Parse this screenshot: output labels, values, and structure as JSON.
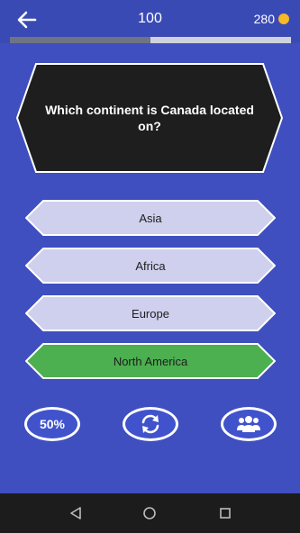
{
  "header": {
    "back_icon": "arrow-left-icon",
    "score": "100",
    "coins": "280",
    "coin_icon": "gold-coin-icon",
    "progress": 0.5
  },
  "question": {
    "text": "Which continent is Canada located on?"
  },
  "options": [
    {
      "label": "Asia",
      "state": "default"
    },
    {
      "label": "Africa",
      "state": "default"
    },
    {
      "label": "Europe",
      "state": "default"
    },
    {
      "label": "North America",
      "state": "correct"
    }
  ],
  "lifelines": {
    "fifty_fifty_label": "50%",
    "swap_icon": "refresh-icon",
    "audience_icon": "group-icon"
  },
  "colors": {
    "background": "#3f4fc0",
    "option_default": "#cfd0ee",
    "option_correct": "#4caf50",
    "question_bg": "#1e1e1e",
    "coin": "#f6b928"
  },
  "system_nav": {
    "back_icon": "nav-back-icon",
    "home_icon": "nav-home-icon",
    "recents_icon": "nav-recents-icon"
  }
}
